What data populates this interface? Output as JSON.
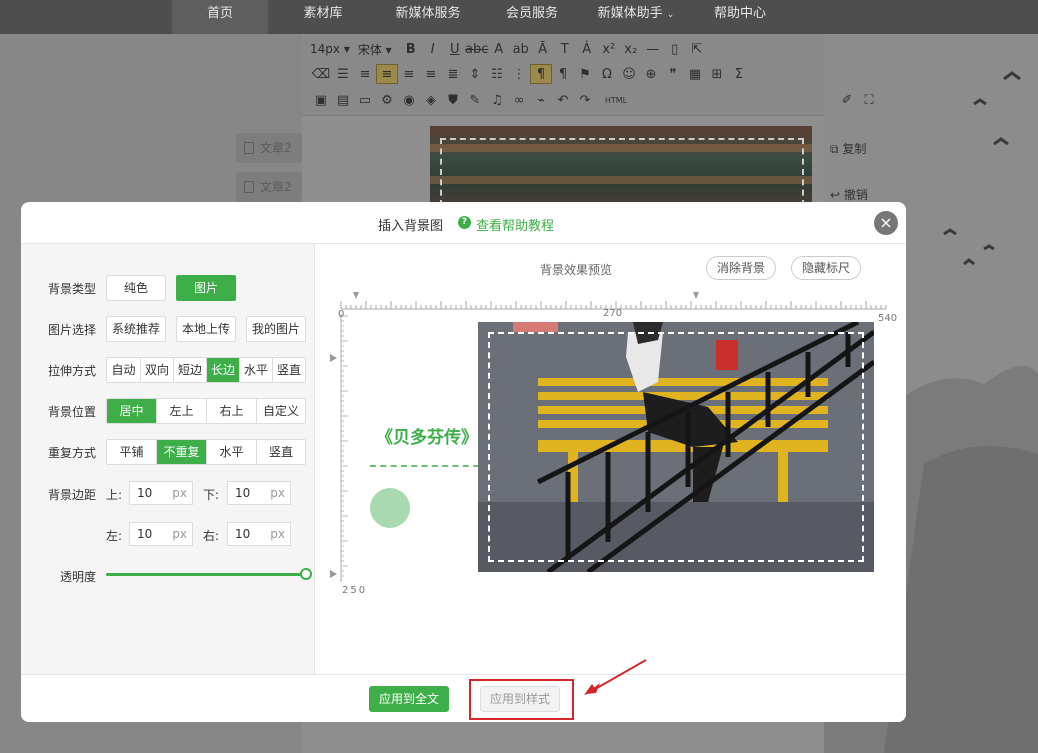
{
  "nav": {
    "items": [
      {
        "label": "首页",
        "active": true
      },
      {
        "label": "素材库"
      },
      {
        "label": "新媒体服务"
      },
      {
        "label": "会员服务"
      },
      {
        "label": "新媒体助手"
      },
      {
        "label": "帮助中心"
      }
    ]
  },
  "toolbar": {
    "font_size": "14px",
    "font_family": "宋体",
    "html_label": "HTML"
  },
  "background": {
    "side_tabs": [
      "文章2",
      "文章2"
    ],
    "copy_label": "复制",
    "undo_label": "撤销"
  },
  "modal": {
    "title": "插入背景图",
    "help_link": "查看帮助教程",
    "close_glyph": "×",
    "settings": {
      "bg_type": {
        "label": "背景类型",
        "options": [
          "纯色",
          "图片"
        ],
        "selected": "图片"
      },
      "image_select": {
        "label": "图片选择",
        "options": [
          "系统推荐",
          "本地上传",
          "我的图片"
        ]
      },
      "stretch": {
        "label": "拉伸方式",
        "options": [
          "自动",
          "双向",
          "短边",
          "长边",
          "水平",
          "竖直"
        ],
        "selected": "长边"
      },
      "position": {
        "label": "背景位置",
        "options": [
          "居中",
          "左上",
          "右上",
          "自定义"
        ],
        "selected": "居中"
      },
      "repeat": {
        "label": "重复方式",
        "options": [
          "平铺",
          "不重复",
          "水平",
          "竖直"
        ],
        "selected": "不重复"
      },
      "margin": {
        "label": "背景边距",
        "unit": "px",
        "top": {
          "label": "上:",
          "value": "10"
        },
        "bottom": {
          "label": "下:",
          "value": "10"
        },
        "left": {
          "label": "左:",
          "value": "10"
        },
        "right": {
          "label": "右:",
          "value": "10"
        }
      },
      "opacity": {
        "label": "透明度",
        "value_fraction": 1.0
      }
    },
    "preview": {
      "title": "背景效果预览",
      "clear_button": "消除背景",
      "hide_ruler_button": "隐藏标尺",
      "ruler": {
        "x_labels": [
          "0",
          "270",
          "540"
        ],
        "y_labels": [
          "250"
        ]
      },
      "article_title": "《贝多芬传》"
    },
    "footer": {
      "apply_all": "应用到全文",
      "apply_style": "应用到样式"
    }
  },
  "colors": {
    "accent_green": "#3dae48",
    "highlight_red": "#d6262c",
    "photo_yellow": "#e0b321"
  }
}
